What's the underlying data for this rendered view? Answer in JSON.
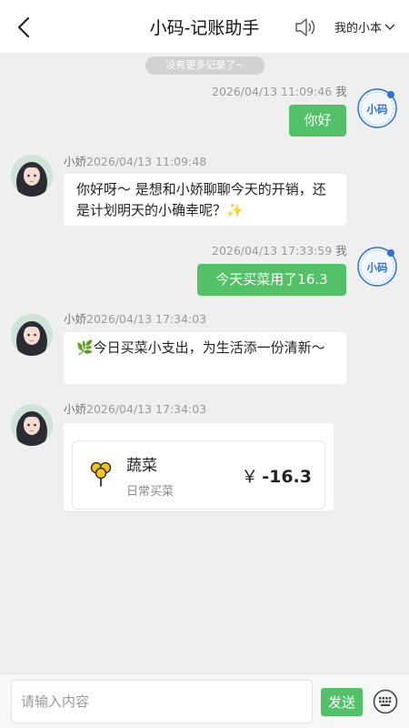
{
  "header": {
    "title": "小码-记账助手",
    "book_label": "我的小本"
  },
  "chat": {
    "no_more_label": "没有更多记录了~",
    "messages": [
      {
        "sender": "我",
        "time": "2026/04/13 11:09:46",
        "text": "你好",
        "avatar_text": "小码"
      },
      {
        "sender": "小娇",
        "time": "2026/04/13 11:09:48",
        "text": "你好呀～ 是想和小娇聊聊今天的开销，还是计划明天的小确幸呢？✨"
      },
      {
        "sender": "我",
        "time": "2026/04/13 17:33:59",
        "text": "今天买菜用了16.3",
        "avatar_text": "小码"
      },
      {
        "sender": "小娇",
        "time": "2026/04/13 17:34:03",
        "text": "🌿今日买菜小支出，为生活添一份清新～"
      },
      {
        "sender": "小娇",
        "time": "2026/04/13 17:34:03",
        "card": {
          "category": "蔬菜",
          "note": "日常买菜",
          "currency": "￥",
          "amount": "-16.3"
        }
      }
    ]
  },
  "footer": {
    "input_placeholder": "请输入内容",
    "input_value": "",
    "send_label": "发送"
  },
  "colors": {
    "accent": "#52c168",
    "background": "#efefef",
    "avatar_blue": "#2f6fd6"
  }
}
